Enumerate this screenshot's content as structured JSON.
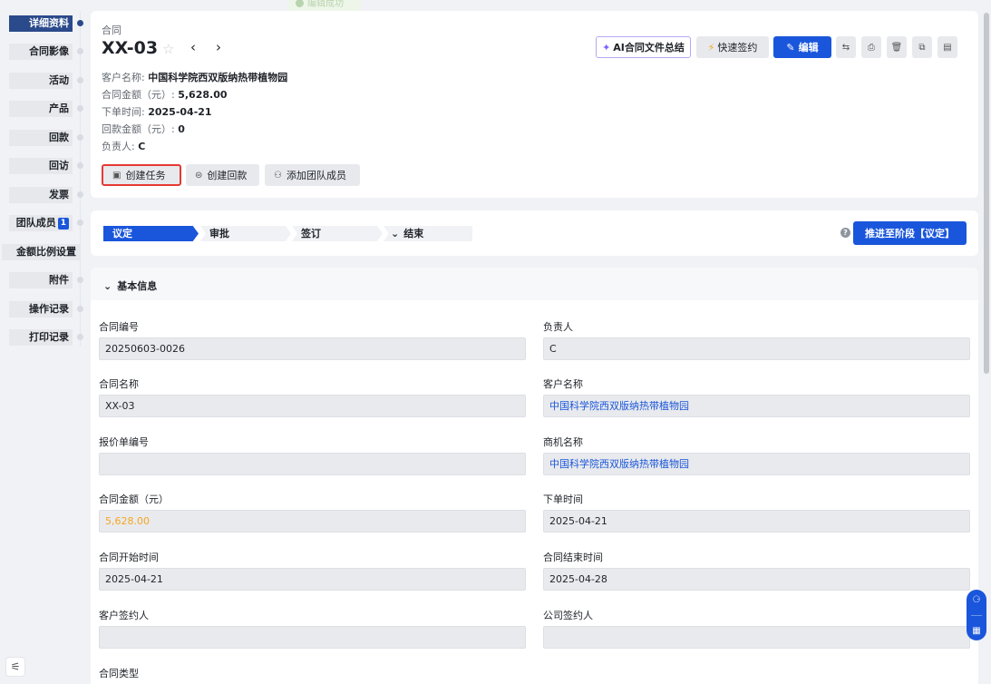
{
  "toast": {
    "text": "编辑成功"
  },
  "nav": {
    "items": [
      {
        "label": "详细资料",
        "active": true
      },
      {
        "label": "合同影像"
      },
      {
        "label": "活动"
      },
      {
        "label": "产品"
      },
      {
        "label": "回款"
      },
      {
        "label": "回访"
      },
      {
        "label": "发票"
      },
      {
        "label": "团队成员",
        "badge": "1"
      },
      {
        "label": "金额比例设置"
      },
      {
        "label": "附件"
      },
      {
        "label": "操作记录"
      },
      {
        "label": "打印记录"
      }
    ]
  },
  "header": {
    "type_label": "合同",
    "title": "XX-03",
    "customer_label": "客户名称:",
    "customer_value": "中国科学院西双版纳热带植物园",
    "amount_label": "合同金额（元）:",
    "amount_value": "5,628.00",
    "order_date_label": "下单时间:",
    "order_date_value": "2025-04-21",
    "payback_label": "回款金额（元）:",
    "payback_value": "0",
    "owner_label": "负责人:",
    "owner_value": "C",
    "ai_summary_label": "AI合同文件总结",
    "quick_sign_label": "快速签约",
    "edit_label": "编辑",
    "actions": {
      "create_task": "创建任务",
      "create_payback": "创建回款",
      "add_member": "添加团队成员"
    }
  },
  "stages": {
    "items": [
      "议定",
      "审批",
      "签订",
      "结束"
    ],
    "advance_label": "推进至阶段【议定】"
  },
  "basic_info": {
    "title": "基本信息",
    "fields": {
      "contract_no": {
        "label": "合同编号",
        "value": "20250603-0026"
      },
      "owner": {
        "label": "负责人",
        "value": "C"
      },
      "contract_name": {
        "label": "合同名称",
        "value": "XX-03"
      },
      "customer": {
        "label": "客户名称",
        "value": "中国科学院西双版纳热带植物园"
      },
      "quote_no": {
        "label": "报价单编号",
        "value": ""
      },
      "opportunity": {
        "label": "商机名称",
        "value": "中国科学院西双版纳热带植物园"
      },
      "amount": {
        "label": "合同金额（元）",
        "value": "5,628.00"
      },
      "order_date": {
        "label": "下单时间",
        "value": "2025-04-21"
      },
      "start_date": {
        "label": "合同开始时间",
        "value": "2025-04-21"
      },
      "end_date": {
        "label": "合同结束时间",
        "value": "2025-04-28"
      },
      "customer_signer": {
        "label": "客户签约人",
        "value": ""
      },
      "company_signer": {
        "label": "公司签约人",
        "value": ""
      },
      "contract_type": {
        "label": "合同类型"
      }
    }
  }
}
